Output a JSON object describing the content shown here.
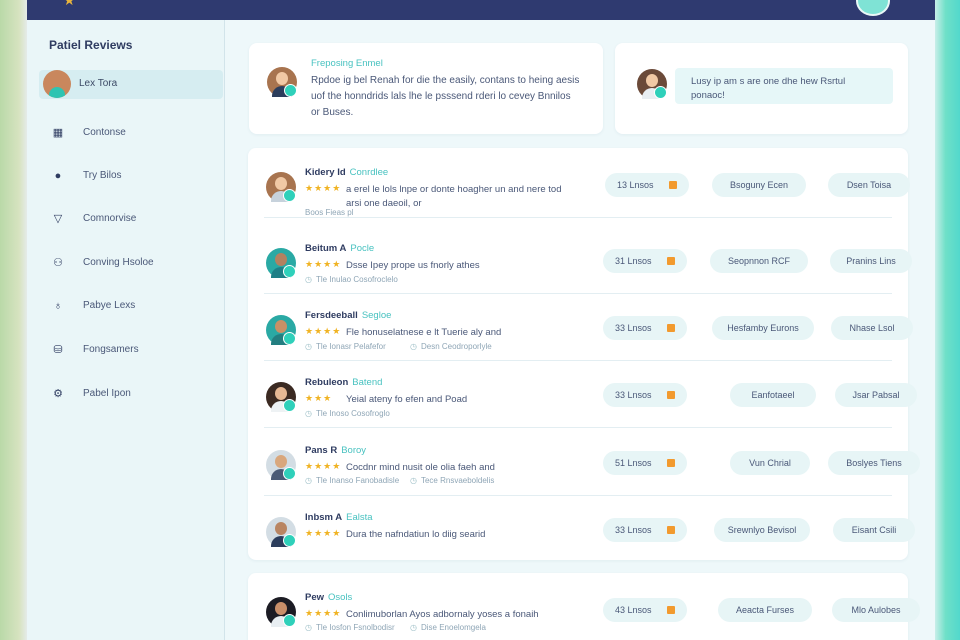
{
  "app": {
    "brand_color": "#2f3a70",
    "accent_color": "#2fd0ba"
  },
  "sidebar": {
    "title": "Patiel Reviews",
    "active_item": "Lex Tora",
    "items": [
      {
        "icon": "building-icon",
        "label": "Contonse"
      },
      {
        "icon": "pin-icon",
        "label": "Try Bilos"
      },
      {
        "icon": "shield-icon",
        "label": "Comnorvise"
      },
      {
        "icon": "users-icon",
        "label": "Conving Hsoloe"
      },
      {
        "icon": "person-icon",
        "label": "Pabye Lexs"
      },
      {
        "icon": "database-icon",
        "label": "Fongsamers"
      },
      {
        "icon": "gear-icon",
        "label": "Pabel Ipon"
      }
    ]
  },
  "top_cards": [
    {
      "title": "Freposing Enmel",
      "text": "Rpdoe ig bel Renah for die the easily, contans to heing aesis uof the honndrids lals lhe le psssend rderi lo cevey Bnnilos or Buses."
    },
    {
      "text": "Lusy ip am s are one dhe hew Rsrtul ponaoc!"
    }
  ],
  "reviews": [
    {
      "name": "Kidery Id",
      "tag": "Conrdlee",
      "stars": "★★★★",
      "text": "a erel le lols lnpe or donte hoagher un and nere tod arsi one daeoil, or",
      "meta": [
        "Boos Fieas pl"
      ],
      "count": "13 Lnsos",
      "pill_a": "Bsoguny Ecen",
      "pill_b": "Dsen Toisa"
    },
    {
      "name": "Beitum A",
      "tag": "Pocle",
      "stars": "★★★★",
      "text": "Dsse Ipey prope us fnorly athes",
      "meta": [
        "Tle Inulao Cosofroclelo"
      ],
      "count": "31 Lnsos",
      "pill_a": "Seopnnon RCF",
      "pill_b": "Pranins Lins"
    },
    {
      "name": "Fersdeeball",
      "tag": "Segloe",
      "stars": "★★★★",
      "text": "Fle honuselatnese e lt Tuerie aly and",
      "meta": [
        "Tle Ionasr Pelafefor",
        "Desn Ceodroporlyle"
      ],
      "count": "33 Lnsos",
      "pill_a": "Hesfamby Eurons",
      "pill_b": "Nhase Lsol"
    },
    {
      "name": "Rebuleon",
      "tag": "Batend",
      "stars": "★★★",
      "text": "Yeial ateny fo efen and Poad",
      "meta": [
        "Tle Inoso Cosofroglo"
      ],
      "count": "33 Lnsos",
      "pill_a": "Eanfotaeel",
      "pill_b": "Jsar Pabsal"
    },
    {
      "name": "Pans R",
      "tag": "Boroy",
      "stars": "★★★★",
      "text": "Cocdnr mind nusit ole olia faeh and",
      "meta": [
        "Tle Inanso Fanobadisle",
        "Tece Rnsvaeboldelis"
      ],
      "count": "51 Lnsos",
      "pill_a": "Vun Chrial",
      "pill_b": "Boslyes Tiens"
    },
    {
      "name": "Inbsm A",
      "tag": "Ealsta",
      "stars": "★★★★",
      "text": "Dura the nafndatiun lo diig searid",
      "meta": [],
      "count": "33 Lnsos",
      "pill_a": "Srewnlyo Bevisol",
      "pill_b": "Eisant Csili"
    }
  ],
  "reviews_2": [
    {
      "name": "Pew",
      "tag": "Osols",
      "stars": "★★★★",
      "text": "Conlimuborlan Ayos adbornaly yoses a fonaih",
      "meta": [
        "Tle Iosfon Fsnolbodisr",
        "Dise Enoelomgela"
      ],
      "count": "43 Lnsos",
      "pill_a": "Aeacta Furses",
      "pill_b": "Mlo Aulobes"
    }
  ]
}
